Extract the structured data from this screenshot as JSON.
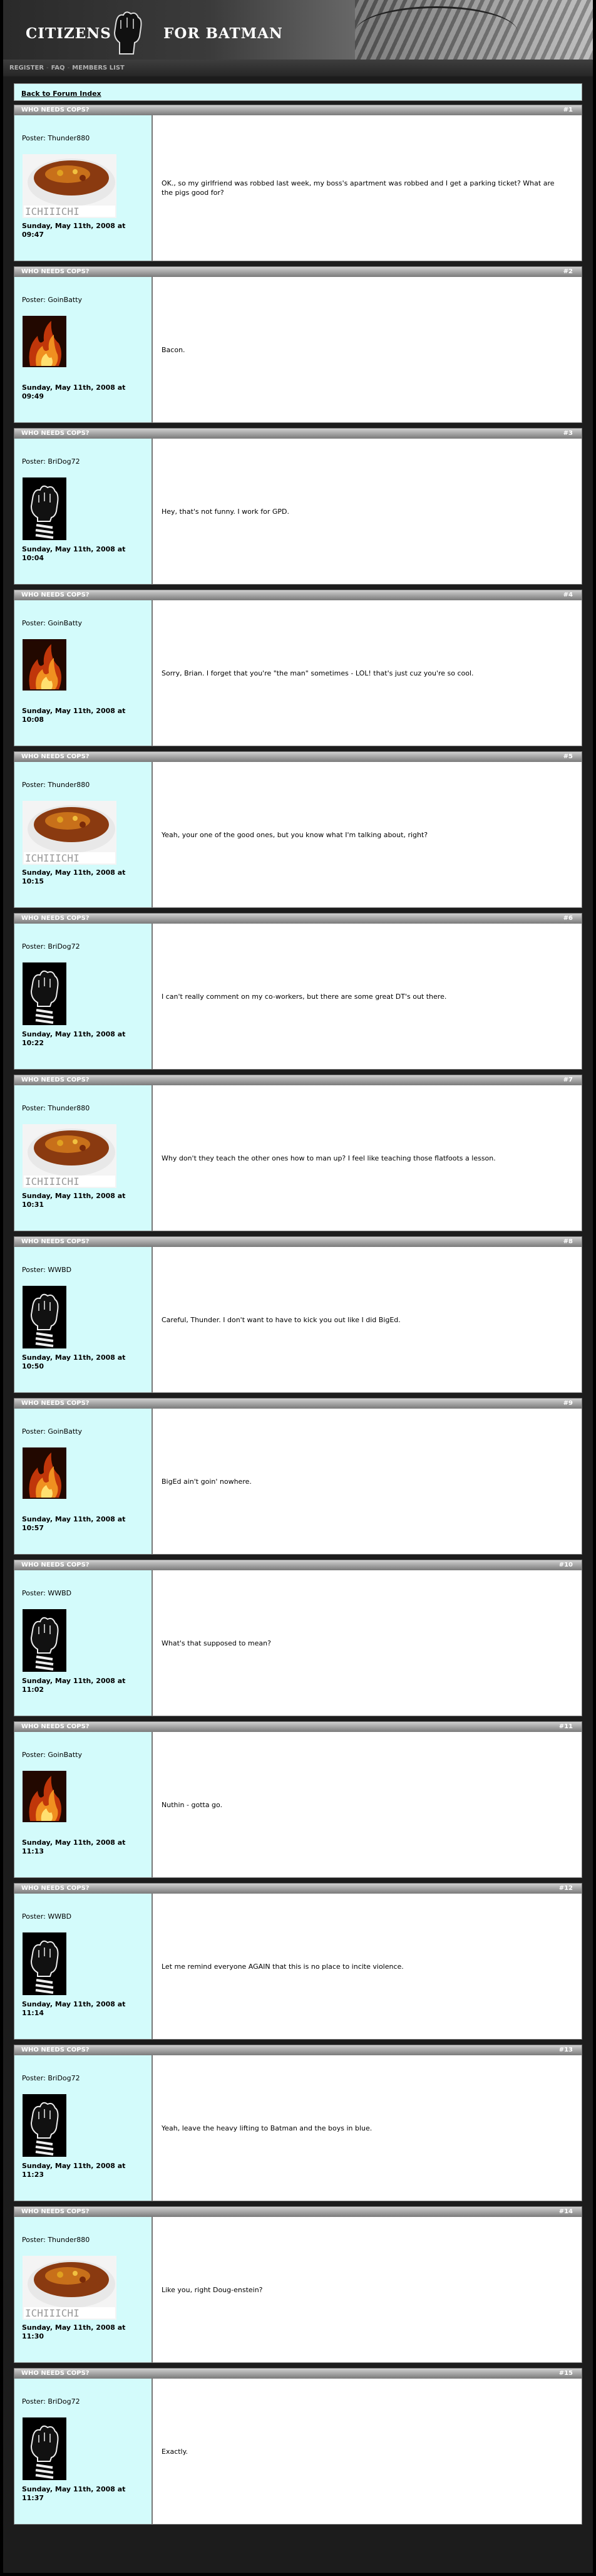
{
  "site": {
    "title_left": "CITIZENS",
    "title_right": "FOR BATMAN"
  },
  "nav": {
    "items": [
      "REGISTER",
      "FAQ",
      "MEMBERS LIST"
    ],
    "separator": "-"
  },
  "back_link": "Back to Forum Index",
  "posts": [
    {
      "title": "WHO NEEDS COPS?",
      "number": "#1",
      "poster": "Poster: Thunder880",
      "avatar": "thunder",
      "date": "Sunday, May 11th, 2008 at 09:47",
      "message": "OK., so my girlfriend was robbed last week, my boss's apartment was robbed and I get a parking ticket? What are the pigs good for?"
    },
    {
      "title": "WHO NEEDS COPS?",
      "number": "#2",
      "poster": "Poster: GoinBatty",
      "avatar": "goin",
      "date": "Sunday, May 11th, 2008 at 09:49",
      "message": "Bacon."
    },
    {
      "title": "WHO NEEDS COPS?",
      "number": "#3",
      "poster": "Poster: BriDog72",
      "avatar": "fist",
      "date": "Sunday, May 11th, 2008 at 10:04",
      "message": "Hey, that's not funny. I work for GPD."
    },
    {
      "title": "WHO NEEDS COPS?",
      "number": "#4",
      "poster": "Poster: GoinBatty",
      "avatar": "goin",
      "date": "Sunday, May 11th, 2008 at 10:08",
      "message": "Sorry, Brian. I forget that you're \"the man\" sometimes - LOL! that's just cuz you're so cool."
    },
    {
      "title": "WHO NEEDS COPS?",
      "number": "#5",
      "poster": "Poster: Thunder880",
      "avatar": "thunder",
      "date": "Sunday, May 11th, 2008 at 10:15",
      "message": "Yeah, your one of the good ones, but you know what I'm talking about, right?"
    },
    {
      "title": "WHO NEEDS COPS?",
      "number": "#6",
      "poster": "Poster: BriDog72",
      "avatar": "fist",
      "date": "Sunday, May 11th, 2008 at 10:22",
      "message": "I can't really comment on my co-workers, but there are some great DT's out there."
    },
    {
      "title": "WHO NEEDS COPS?",
      "number": "#7",
      "poster": "Poster: Thunder880",
      "avatar": "thunder",
      "date": "Sunday, May 11th, 2008 at 10:31",
      "message": "Why don't they teach the other ones how to man up? I feel like teaching those flatfoots a lesson."
    },
    {
      "title": "WHO NEEDS COPS?",
      "number": "#8",
      "poster": "Poster: WWBD",
      "avatar": "fist",
      "date": "Sunday, May 11th, 2008 at 10:50",
      "message": "Careful, Thunder. I don't want to have to kick you out like I did BigEd."
    },
    {
      "title": "WHO NEEDS COPS?",
      "number": "#9",
      "poster": "Poster: GoinBatty",
      "avatar": "goin",
      "date": "Sunday, May 11th, 2008 at 10:57",
      "message": "BigEd ain't goin' nowhere."
    },
    {
      "title": "WHO NEEDS COPS?",
      "number": "#10",
      "poster": "Poster: WWBD",
      "avatar": "fist",
      "date": "Sunday, May 11th, 2008 at 11:02",
      "message": "What's that supposed to mean?"
    },
    {
      "title": "WHO NEEDS COPS?",
      "number": "#11",
      "poster": "Poster: GoinBatty",
      "avatar": "goin",
      "date": "Sunday, May 11th, 2008 at 11:13",
      "message": "Nuthin - gotta go."
    },
    {
      "title": "WHO NEEDS COPS?",
      "number": "#12",
      "poster": "Poster: WWBD",
      "avatar": "fist",
      "date": "Sunday, May 11th, 2008 at 11:14",
      "message": "Let me remind everyone AGAIN that this is no place to incite violence."
    },
    {
      "title": "WHO NEEDS COPS?",
      "number": "#13",
      "poster": "Poster: BriDog72",
      "avatar": "fist",
      "date": "Sunday, May 11th, 2008 at 11:23",
      "message": "Yeah, leave the heavy lifting to Batman and the boys in blue."
    },
    {
      "title": "WHO NEEDS COPS?",
      "number": "#14",
      "poster": "Poster: Thunder880",
      "avatar": "thunder",
      "date": "Sunday, May 11th, 2008 at 11:30",
      "message": "Like you, right Doug-enstein?"
    },
    {
      "title": "WHO NEEDS COPS?",
      "number": "#15",
      "poster": "Poster: BriDog72",
      "avatar": "fist",
      "date": "Sunday, May 11th, 2008 at 11:37",
      "message": "Exactly."
    }
  ]
}
